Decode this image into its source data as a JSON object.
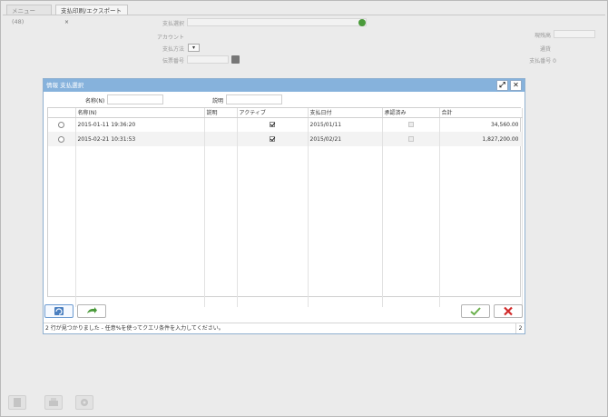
{
  "tabs": [
    {
      "label": "メニュー (48)"
    },
    {
      "label": "支払印刷/エクスポート",
      "close": "×"
    }
  ],
  "form": {
    "payment_selection_label": "支払選択",
    "account_label": "アカウント",
    "payment_method_label": "支払方法",
    "document_no_label": "伝票番号",
    "current_balance_label": "現残高",
    "currency_label": "通貨",
    "payment_no_label": "支払番号 0"
  },
  "dialog": {
    "title": "情報 支払選択",
    "maximize": "⤢",
    "close": "✕",
    "name_label": "名称(N)",
    "desc_label": "説明",
    "columns": [
      "",
      "名称(N)",
      "説明",
      "アクティブ",
      "支払日付",
      "承認済み",
      "合計"
    ],
    "rows": [
      {
        "name": "2015-01-11 19:36:20",
        "description": "",
        "active": true,
        "pay_date": "2015/01/11",
        "approved": false,
        "total": "34,560.00"
      },
      {
        "name": "2015-02-21 10:31:53",
        "description": "",
        "active": true,
        "pay_date": "2015/02/21",
        "approved": false,
        "total": "1,827,200.00"
      }
    ],
    "status_text": "2 行が見つかりました - 任意%を使ってクエリ条件を入力してください。",
    "status_count": "2"
  },
  "colors": {
    "title_bar": "#86b2dc",
    "ok_green": "#4a9a3a",
    "cancel_red": "#d12a2a"
  }
}
